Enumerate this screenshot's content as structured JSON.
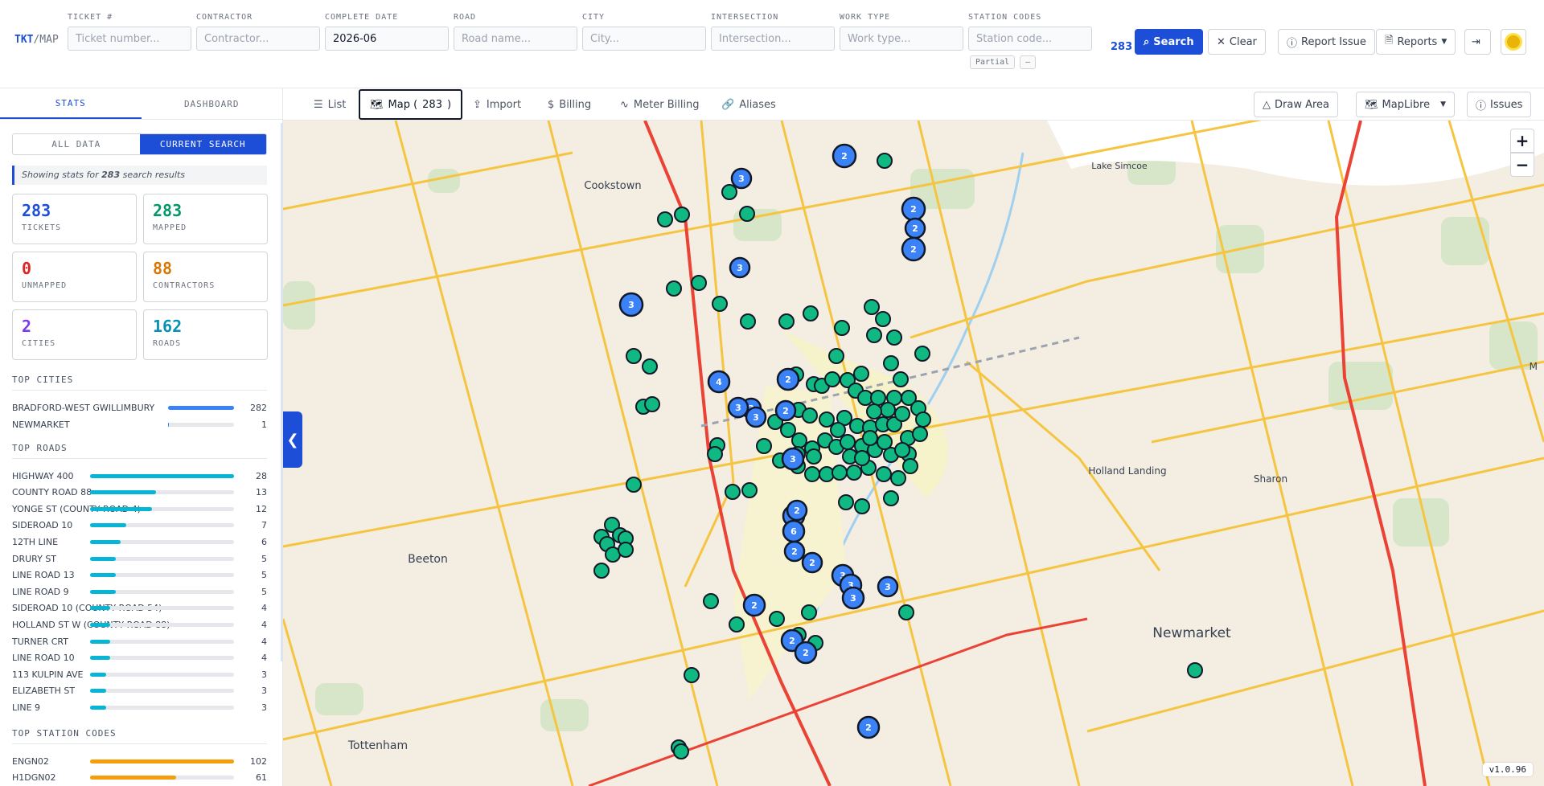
{
  "app": {
    "logo_primary": "TKT",
    "logo_secondary": "/MAP"
  },
  "filters": [
    {
      "label": "TICKET #",
      "placeholder": "Ticket number...",
      "value": ""
    },
    {
      "label": "CONTRACTOR",
      "placeholder": "Contractor...",
      "value": ""
    },
    {
      "label": "COMPLETE DATE",
      "placeholder": "",
      "value": "2026-06"
    },
    {
      "label": "ROAD",
      "placeholder": "Road name...",
      "value": ""
    },
    {
      "label": "CITY",
      "placeholder": "City...",
      "value": ""
    },
    {
      "label": "INTERSECTION",
      "placeholder": "Intersection...",
      "value": ""
    },
    {
      "label": "WORK TYPE",
      "placeholder": "Work type...",
      "value": ""
    },
    {
      "label": "STATION CODES",
      "placeholder": "Station code...",
      "value": ""
    }
  ],
  "station_chips": [
    "Partial",
    "–"
  ],
  "result_count": "283",
  "toolbar": {
    "search": "Search",
    "clear": "Clear",
    "report_issue": "Report Issue",
    "reports": "Reports"
  },
  "sidebar": {
    "tabs": [
      "STATS",
      "DASHBOARD"
    ],
    "scope": [
      "ALL DATA",
      "CURRENT SEARCH"
    ],
    "note_prefix": "Showing stats for ",
    "note_count": "283",
    "note_suffix": " search results",
    "cards": [
      {
        "value": "283",
        "label": "TICKETS",
        "color": "#1d4ed8"
      },
      {
        "value": "283",
        "label": "MAPPED",
        "color": "#059669"
      },
      {
        "value": "0",
        "label": "UNMAPPED",
        "color": "#dc2626"
      },
      {
        "value": "88",
        "label": "CONTRACTORS",
        "color": "#d97706"
      },
      {
        "value": "2",
        "label": "CITIES",
        "color": "#7c3aed"
      },
      {
        "value": "162",
        "label": "ROADS",
        "color": "#0891b2"
      }
    ],
    "top_cities_title": "TOP CITIES",
    "top_cities": [
      {
        "name": "BRADFORD-WEST GWILLIMBURY",
        "count": "282",
        "fill": 1.0
      },
      {
        "name": "NEWMARKET",
        "count": "1",
        "fill": 0.01
      }
    ],
    "top_roads_title": "TOP ROADS",
    "top_roads": [
      {
        "name": "HIGHWAY 400",
        "count": "28",
        "fill": 1.0
      },
      {
        "name": "COUNTY ROAD 88",
        "count": "13",
        "fill": 0.46
      },
      {
        "name": "YONGE ST (COUNTY ROAD 4)",
        "count": "12",
        "fill": 0.43
      },
      {
        "name": "SIDEROAD 10",
        "count": "7",
        "fill": 0.25
      },
      {
        "name": "12TH LINE",
        "count": "6",
        "fill": 0.21
      },
      {
        "name": "DRURY ST",
        "count": "5",
        "fill": 0.18
      },
      {
        "name": "LINE ROAD 13",
        "count": "5",
        "fill": 0.18
      },
      {
        "name": "LINE ROAD 9",
        "count": "5",
        "fill": 0.18
      },
      {
        "name": "SIDEROAD 10 (COUNTY ROAD 54)",
        "count": "4",
        "fill": 0.14
      },
      {
        "name": "HOLLAND ST W (COUNTY ROAD 88)",
        "count": "4",
        "fill": 0.14
      },
      {
        "name": "TURNER CRT",
        "count": "4",
        "fill": 0.14
      },
      {
        "name": "LINE ROAD 10",
        "count": "4",
        "fill": 0.14
      },
      {
        "name": "113 KULPIN AVE",
        "count": "3",
        "fill": 0.11
      },
      {
        "name": "ELIZABETH ST",
        "count": "3",
        "fill": 0.11
      },
      {
        "name": "LINE 9",
        "count": "3",
        "fill": 0.11
      }
    ],
    "top_station_title": "TOP STATION CODES",
    "top_station_codes": [
      {
        "name": "ENGN02",
        "count": "102",
        "fill": 1.0
      },
      {
        "name": "H1DGN02",
        "count": "61",
        "fill": 0.6
      }
    ]
  },
  "views": {
    "list": "List",
    "map_prefix": "Map ( ",
    "map_count": "283",
    "map_suffix": " )",
    "import": "Import",
    "billing": "Billing",
    "meter_billing": "Meter Billing",
    "aliases": "Aliases",
    "draw_area": "Draw Area",
    "map_style": "MapLibre",
    "issues": "Issues"
  },
  "map": {
    "places": [
      "Cookstown",
      "Lake Simcoe",
      "Holland Landing",
      "Sharon",
      "Beeton",
      "Newmarket",
      "Tottenham",
      "M"
    ],
    "cluster_counts": [
      "2",
      "3",
      "2",
      "2",
      "2",
      "3",
      "3",
      "4",
      "2",
      "2",
      "3",
      "3",
      "3",
      "3",
      "4",
      "2",
      "6",
      "2",
      "2",
      "3",
      "2",
      "2",
      "3",
      "3",
      "2",
      "3",
      "2"
    ],
    "version": "v1.0.96"
  },
  "colors": {
    "accent": "#1d4ed8",
    "cluster": "#3b82f6",
    "marker": "#10b981",
    "highway": "#ea4335",
    "road": "#f5c542"
  }
}
